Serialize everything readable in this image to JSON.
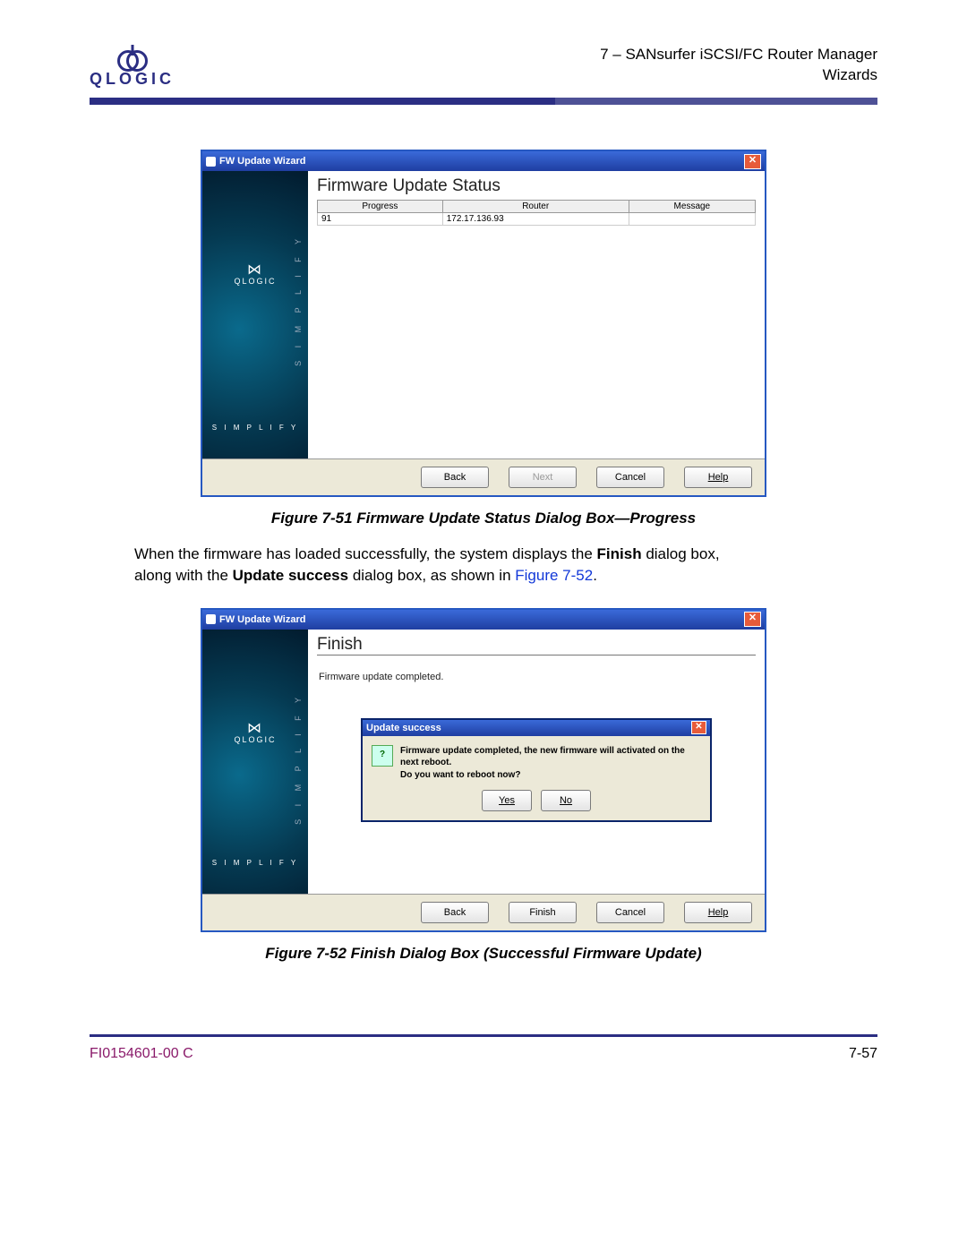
{
  "header": {
    "chapter_line": "7 – SANsurfer iSCSI/FC Router Manager",
    "section_line": "Wizards",
    "brand": "QLOGIC"
  },
  "figure1": {
    "window_title": "FW Update Wizard",
    "heading": "Firmware Update Status",
    "columns": [
      "Progress",
      "Router",
      "Message"
    ],
    "row": {
      "progress": "91",
      "router": "172.17.136.93",
      "message": ""
    },
    "buttons": {
      "back": "Back",
      "next": "Next",
      "cancel": "Cancel",
      "help": "Help"
    },
    "sidepanel": {
      "brand": "QLOGIC",
      "vertical": "S I M P L I F Y",
      "horizontal": "S I M P L I F Y"
    },
    "caption": "Figure 7-51  Firmware Update Status Dialog Box—Progress"
  },
  "paragraph": {
    "t1": "When the firmware has loaded successfully, the system displays the ",
    "bold1": "Finish",
    "t2": " dialog box, along with the ",
    "bold2": "Update success",
    "t3": " dialog box, as shown in ",
    "link": "Figure 7-52",
    "t4": "."
  },
  "figure2": {
    "window_title": "FW Update Wizard",
    "heading": "Finish",
    "status_msg": "Firmware update completed.",
    "popup": {
      "title": "Update success",
      "line1": "Firmware update completed, the new firmware will activated on the next reboot.",
      "line2": "Do you want to reboot now?",
      "yes": "Yes",
      "no": "No"
    },
    "buttons": {
      "back": "Back",
      "finish": "Finish",
      "cancel": "Cancel",
      "help": "Help"
    },
    "sidepanel": {
      "brand": "QLOGIC",
      "vertical": "S I M P L I F Y",
      "horizontal": "S I M P L I F Y"
    },
    "caption": "Figure 7-52  Finish Dialog Box (Successful Firmware Update)"
  },
  "footer": {
    "docnum": "FI0154601-00  C",
    "pagenum": "7-57"
  }
}
